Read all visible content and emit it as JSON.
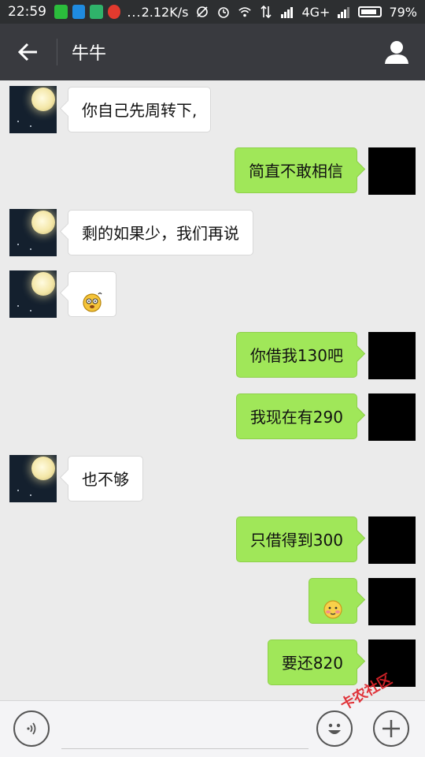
{
  "status_bar": {
    "time": "22:59",
    "network_speed": "2.12K/s",
    "network_type": "4G+",
    "battery": "79%",
    "overflow_dots": "..."
  },
  "header": {
    "title": "牛牛",
    "back_icon": "arrow-left-icon",
    "profile_icon": "person-icon"
  },
  "messages": [
    {
      "side": "left",
      "type": "text",
      "text": "你自己先周转下,"
    },
    {
      "side": "right",
      "type": "text",
      "text": "简直不敢相信"
    },
    {
      "side": "left",
      "type": "text",
      "text": "剩的如果少，我们再说"
    },
    {
      "side": "left",
      "type": "emoji",
      "emoji": "dizzy-face-emoji"
    },
    {
      "side": "right",
      "type": "text",
      "text": "你借我130吧"
    },
    {
      "side": "right",
      "type": "text",
      "text": "我现在有290"
    },
    {
      "side": "left",
      "type": "text",
      "text": "也不够"
    },
    {
      "side": "right",
      "type": "text",
      "text": "只借得到300"
    },
    {
      "side": "right",
      "type": "emoji",
      "emoji": "blushing-face-emoji"
    },
    {
      "side": "right",
      "type": "text",
      "text": "要还820"
    }
  ],
  "input_bar": {
    "placeholder": "",
    "voice_icon": "voice-icon",
    "emoji_icon": "smiley-icon",
    "plus_icon": "plus-icon"
  },
  "watermark": "卡农社区",
  "colors": {
    "header_bg": "#393a3f",
    "status_bg": "#2d2f31",
    "chat_bg": "#ebebeb",
    "bubble_self": "#a0e759",
    "bubble_other": "#ffffff"
  }
}
